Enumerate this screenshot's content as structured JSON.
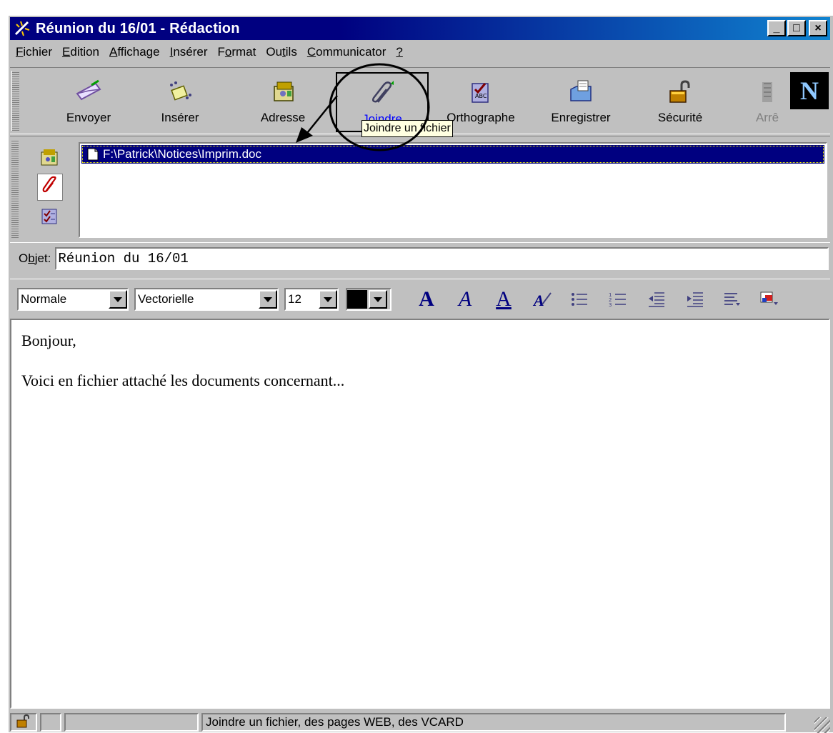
{
  "window": {
    "title": "Réunion du 16/01 - Rédaction",
    "controls": {
      "minimize": "_",
      "maximize": "□",
      "close": "×"
    }
  },
  "menubar": {
    "items": [
      {
        "pre": "",
        "key": "F",
        "post": "ichier"
      },
      {
        "pre": "",
        "key": "E",
        "post": "dition"
      },
      {
        "pre": "",
        "key": "A",
        "post": "ffichage"
      },
      {
        "pre": "",
        "key": "I",
        "post": "nsérer"
      },
      {
        "pre": "F",
        "key": "o",
        "post": "rmat"
      },
      {
        "pre": "Ou",
        "key": "t",
        "post": "ils"
      },
      {
        "pre": "",
        "key": "C",
        "post": "ommunicator"
      },
      {
        "pre": "",
        "key": "?",
        "post": ""
      }
    ]
  },
  "toolbar": {
    "send": "Envoyer",
    "insert": "Insérer",
    "address": "Adresse",
    "attach": "Joindre",
    "spelling": "Orthographe",
    "save": "Enregistrer",
    "security": "Sécurité",
    "stop": "Arrê",
    "logo": "N"
  },
  "attachments": {
    "items": [
      "F:\\Patrick\\Notices\\Imprim.doc"
    ]
  },
  "tooltip": "Joindre un fichier",
  "subject": {
    "label": "Objet:",
    "value": "Réunion du 16/01"
  },
  "format": {
    "style": "Normale",
    "font": "Vectorielle",
    "size": "12",
    "color": "#000000"
  },
  "body": {
    "lines": [
      "Bonjour,",
      "Voici en fichier attaché les documents concernant..."
    ]
  },
  "status": {
    "message": "Joindre un fichier, des pages WEB, des VCARD"
  }
}
